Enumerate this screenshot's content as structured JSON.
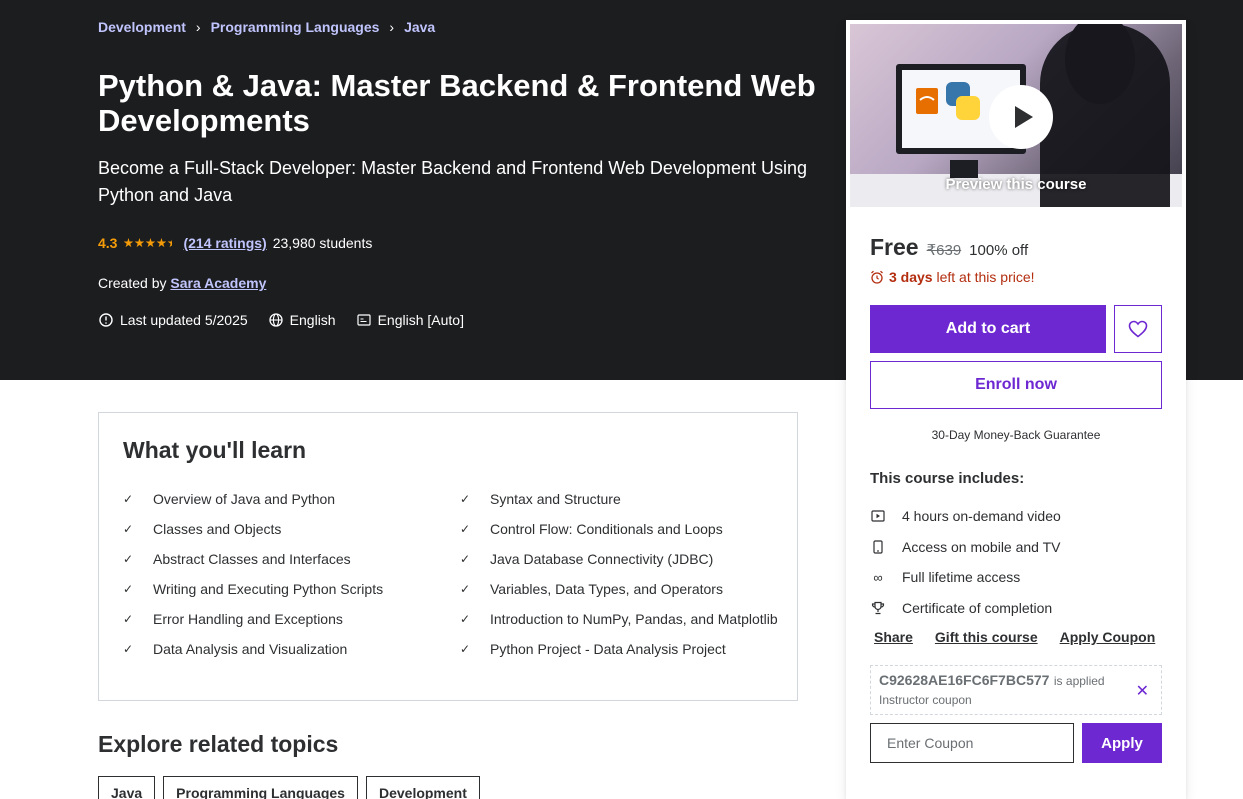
{
  "breadcrumb": [
    "Development",
    "Programming Languages",
    "Java"
  ],
  "course": {
    "title": "Python & Java: Master Backend & Frontend Web Developments",
    "subtitle": "Become a Full-Stack Developer: Master Backend and Frontend Web Development Using Python and Java",
    "rating": "4.3",
    "rating_stars": 4.5,
    "ratings_count": "(214 ratings)",
    "students": "23,980 students",
    "created_by_label": "Created by",
    "instructor": "Sara Academy",
    "last_updated": "Last updated 5/2025",
    "language": "English",
    "captions": "English [Auto]"
  },
  "learn": {
    "title": "What you'll learn",
    "items": [
      "Overview of Java and Python",
      "Syntax and Structure",
      "Classes and Objects",
      "Control Flow: Conditionals and Loops",
      "Abstract Classes and Interfaces",
      "Java Database Connectivity (JDBC)",
      "Writing and Executing Python Scripts",
      "Variables, Data Types, and Operators",
      "Error Handling and Exceptions",
      "Introduction to NumPy, Pandas, and Matplotlib",
      "Data Analysis and Visualization",
      "Python Project - Data Analysis Project"
    ]
  },
  "related": {
    "title": "Explore related topics",
    "tags": [
      "Java",
      "Programming Languages",
      "Development"
    ]
  },
  "sidebar": {
    "preview_label": "Preview this course",
    "price": "Free",
    "original_price": "₹639",
    "discount": "100% off",
    "timer_bold": "3 days",
    "timer_rest": "left at this price!",
    "add_to_cart": "Add to cart",
    "enroll_now": "Enroll now",
    "guarantee": "30-Day Money-Back Guarantee",
    "includes_title": "This course includes:",
    "includes": [
      {
        "icon": "video-icon",
        "label": "4 hours on-demand video"
      },
      {
        "icon": "mobile-icon",
        "label": "Access on mobile and TV"
      },
      {
        "icon": "infinity-icon",
        "label": "Full lifetime access"
      },
      {
        "icon": "trophy-icon",
        "label": "Certificate of completion"
      }
    ],
    "share": "Share",
    "gift": "Gift this course",
    "apply_coupon": "Apply Coupon",
    "coupon_code": "C92628AE16FC6F7BC577",
    "coupon_applied": "is applied",
    "coupon_type": "Instructor coupon",
    "coupon_placeholder": "Enter Coupon",
    "apply": "Apply"
  },
  "colors": {
    "hero_bg": "#1c1d1f",
    "accent_purple": "#6d28d2",
    "link_lavender": "#c0c4fc",
    "rating_orange": "#f69c08",
    "timer_red": "#b32d0f"
  }
}
